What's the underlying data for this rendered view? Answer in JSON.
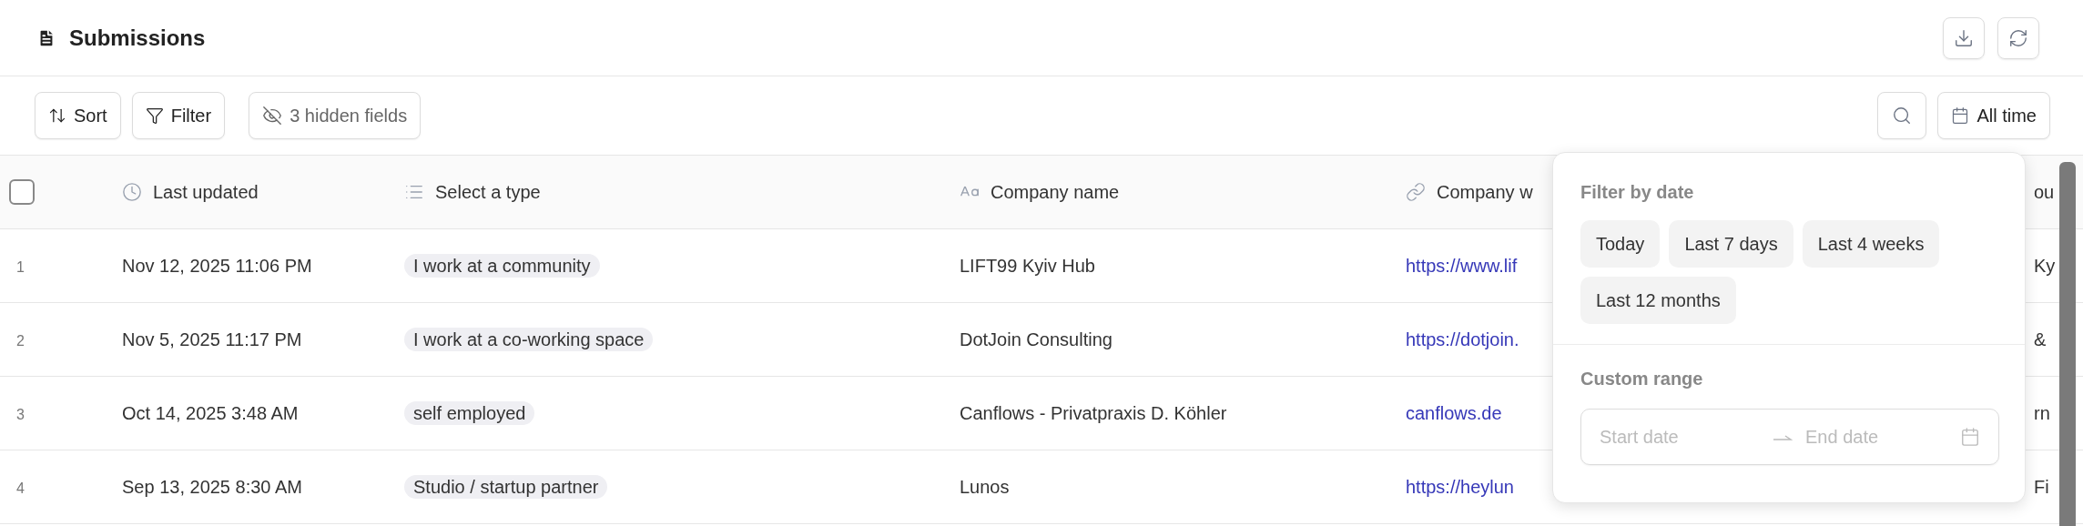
{
  "header": {
    "title": "Submissions"
  },
  "toolbar": {
    "sort": "Sort",
    "filter": "Filter",
    "hidden_fields": "3 hidden fields",
    "date_button": "All time"
  },
  "table": {
    "columns": [
      {
        "label": "Last updated",
        "kind": "date"
      },
      {
        "label": "Select a type",
        "kind": "select"
      },
      {
        "label": "Company name",
        "kind": "text"
      },
      {
        "label": "Company w",
        "kind": "link"
      },
      {
        "label": "ou",
        "kind": "plain"
      }
    ],
    "all_selected": false,
    "rows": [
      {
        "number": "1",
        "cells": [
          "Nov 12, 2025 11:06 PM",
          "I work at a community",
          "LIFT99 Kyiv Hub",
          "https://www.lif",
          "Ky"
        ]
      },
      {
        "number": "2",
        "cells": [
          "Nov 5, 2025 11:17 PM",
          "I work at a co-working space",
          "DotJoin Consulting",
          "https://dotjoin.",
          "&"
        ]
      },
      {
        "number": "3",
        "cells": [
          "Oct 14, 2025 3:48 AM",
          "self employed",
          "Canflows - Privatpraxis D. Köhler",
          "canflows.de",
          "rn"
        ]
      },
      {
        "number": "4",
        "cells": [
          "Sep 13, 2025 8:30 AM",
          "Studio / startup partner",
          "Lunos",
          "https://heylun",
          "Fi"
        ]
      }
    ]
  },
  "date_popover": {
    "title": "Filter by date",
    "presets": [
      "Today",
      "Last 7 days",
      "Last 4 weeks",
      "Last 12 months"
    ],
    "custom_title": "Custom range",
    "start_placeholder": "Start date",
    "end_placeholder": "End date"
  }
}
